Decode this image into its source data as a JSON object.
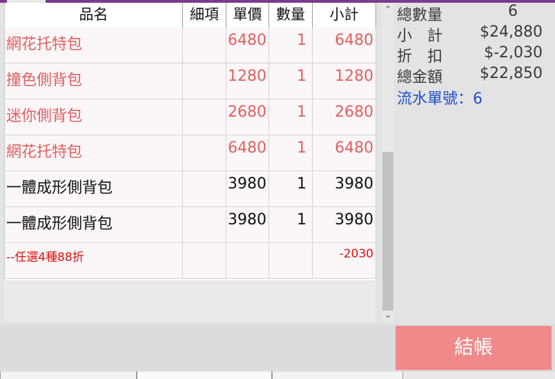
{
  "colors": {
    "accent_purple": "#7b3a8c",
    "item_red": "#e06060",
    "discount_red": "#e01010",
    "serial_blue": "#1f4ec8",
    "checkout_bg": "#f08a8a"
  },
  "table": {
    "headers": [
      "品名",
      "細項",
      "單價",
      "數量",
      "小計"
    ],
    "rows": [
      {
        "name": "網花托特包",
        "detail": "",
        "price": "6480",
        "qty": "1",
        "subtotal": "6480",
        "color": "#e06060"
      },
      {
        "name": "撞色側背包",
        "detail": "",
        "price": "1280",
        "qty": "1",
        "subtotal": "1280",
        "color": "#e06060"
      },
      {
        "name": "迷你側背包",
        "detail": "",
        "price": "2680",
        "qty": "1",
        "subtotal": "2680",
        "color": "#e06060"
      },
      {
        "name": "網花托特包",
        "detail": "",
        "price": "6480",
        "qty": "1",
        "subtotal": "6480",
        "color": "#e06060"
      },
      {
        "name": "一體成形側背包",
        "detail": "",
        "price": "3980",
        "qty": "1",
        "subtotal": "3980",
        "color": "#111111"
      },
      {
        "name": "一體成形側背包",
        "detail": "",
        "price": "3980",
        "qty": "1",
        "subtotal": "3980",
        "color": "#111111"
      },
      {
        "name": "--任選4種88折",
        "detail": "",
        "price": "",
        "qty": "",
        "subtotal": "-2030",
        "color": "#e01010",
        "discount": true
      }
    ]
  },
  "summary": {
    "total_qty_label": "總數量",
    "total_qty": "6",
    "subtotal_label": "小　計",
    "subtotal": "$24,880",
    "discount_label": "折　扣",
    "discount": "$-2,030",
    "total_label": "總金額",
    "total": "$22,850",
    "serial": "流水單號：6"
  },
  "checkout_label": "結帳",
  "scroll": {
    "up_icon": "chevron-up-icon",
    "down_icon": "chevron-down-icon"
  }
}
